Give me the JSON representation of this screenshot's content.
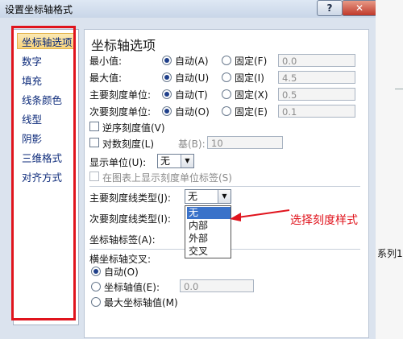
{
  "window": {
    "title": "设置坐标轴格式",
    "help": "?",
    "close": "✕"
  },
  "nav": {
    "items": [
      "坐标轴选项",
      "数字",
      "填充",
      "线条颜色",
      "线型",
      "阴影",
      "三维格式",
      "对齐方式"
    ]
  },
  "section_title": "坐标轴选项",
  "rows": {
    "min": {
      "label": "最小值:",
      "auto": "自动(A)",
      "fixed": "固定(F)",
      "value": "0.0"
    },
    "max": {
      "label": "最大值:",
      "auto": "自动(U)",
      "fixed": "固定(I)",
      "value": "4.5"
    },
    "major": {
      "label": "主要刻度单位:",
      "auto": "自动(T)",
      "fixed": "固定(X)",
      "value": "0.5"
    },
    "minor": {
      "label": "次要刻度单位:",
      "auto": "自动(O)",
      "fixed": "固定(E)",
      "value": "0.1"
    }
  },
  "options": {
    "reverse": "逆序刻度值(V)",
    "log": "对数刻度(L)",
    "base_label": "基(B):",
    "base_value": "10",
    "display_units_label": "显示单位(U):",
    "display_units_value": "无",
    "show_units_label": "在图表上显示刻度单位标签(S)"
  },
  "tick": {
    "major_label": "主要刻度线类型(J):",
    "major_value": "无",
    "minor_label": "次要刻度线类型(I):",
    "axis_labels_label": "坐标轴标签(A):"
  },
  "dropdown": {
    "options": [
      "无",
      "内部",
      "外部",
      "交叉"
    ]
  },
  "cross": {
    "title": "横坐标轴交叉:",
    "auto": "自动(O)",
    "axis_value": "坐标轴值(E):",
    "axis_value_field": "0.0",
    "max_axis": "最大坐标轴值(M)"
  },
  "annotation": "选择刻度样式",
  "background_text": "系列1",
  "colors": {
    "annotation": "#e0141d",
    "selection": "#3a72c9"
  }
}
